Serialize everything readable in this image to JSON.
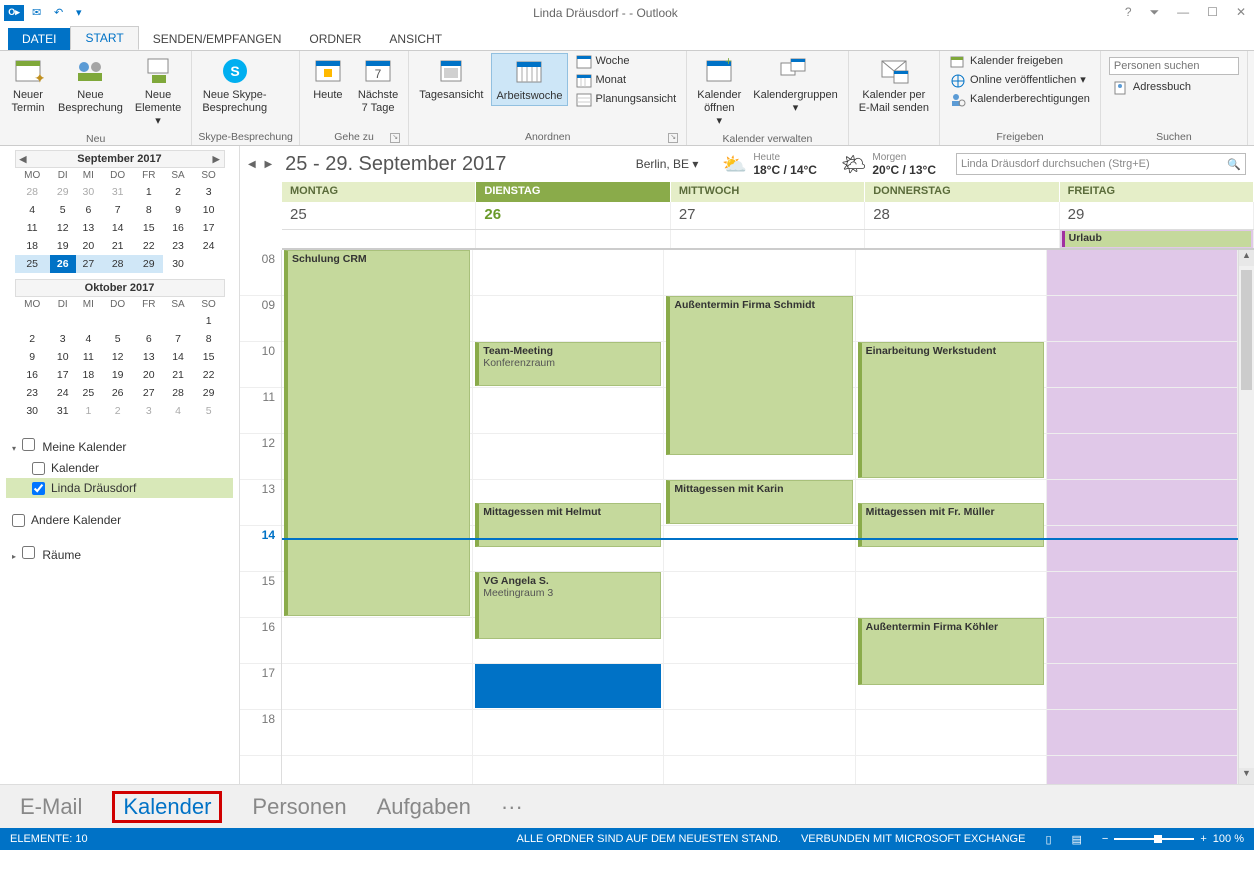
{
  "title": "Linda Dräusdorf -                                               - Outlook",
  "tabs": {
    "file": "DATEI",
    "start": "START",
    "sendrecv": "SENDEN/EMPFANGEN",
    "folder": "ORDNER",
    "view": "ANSICHT"
  },
  "ribbon": {
    "neu": {
      "label": "Neu",
      "termin": "Neuer\nTermin",
      "besp": "Neue\nBesprechung",
      "elem": "Neue\nElemente"
    },
    "skype": {
      "label": "Skype-Besprechung",
      "btn": "Neue Skype-\nBesprechung"
    },
    "gehe": {
      "label": "Gehe zu",
      "heute": "Heute",
      "tage7": "Nächste\n7 Tage"
    },
    "anord": {
      "label": "Anordnen",
      "tag": "Tagesansicht",
      "aw": "Arbeitswoche",
      "woche": "Woche",
      "monat": "Monat",
      "plan": "Planungsansicht"
    },
    "verw": {
      "label": "Kalender verwalten",
      "open": "Kalender\nöffnen",
      "grp": "Kalendergruppen"
    },
    "mail": {
      "label": "",
      "send": "Kalender per\nE-Mail senden"
    },
    "freig": {
      "label": "Freigeben",
      "share": "Kalender freigeben",
      "pub": "Online veröffentlichen",
      "perm": "Kalenderberechtigungen"
    },
    "suchen": {
      "label": "Suchen",
      "placeholder": "Personen suchen",
      "addr": "Adressbuch"
    }
  },
  "mini1": {
    "title": "September 2017",
    "dows": [
      "MO",
      "DI",
      "MI",
      "DO",
      "FR",
      "SA",
      "SO"
    ],
    "rows": [
      [
        "28",
        "29",
        "30",
        "31",
        "1",
        "2",
        "3"
      ],
      [
        "4",
        "5",
        "6",
        "7",
        "8",
        "9",
        "10"
      ],
      [
        "11",
        "12",
        "13",
        "14",
        "15",
        "16",
        "17"
      ],
      [
        "18",
        "19",
        "20",
        "21",
        "22",
        "23",
        "24"
      ],
      [
        "25",
        "26",
        "27",
        "28",
        "29",
        "30",
        ""
      ]
    ]
  },
  "mini2": {
    "title": "Oktober 2017",
    "dows": [
      "MO",
      "DI",
      "MI",
      "DO",
      "FR",
      "SA",
      "SO"
    ],
    "rows": [
      [
        "",
        "",
        "",
        "",
        "",
        "",
        "1"
      ],
      [
        "2",
        "3",
        "4",
        "5",
        "6",
        "7",
        "8"
      ],
      [
        "9",
        "10",
        "11",
        "12",
        "13",
        "14",
        "15"
      ],
      [
        "16",
        "17",
        "18",
        "19",
        "20",
        "21",
        "22"
      ],
      [
        "23",
        "24",
        "25",
        "26",
        "27",
        "28",
        "29"
      ],
      [
        "30",
        "31",
        "1",
        "2",
        "3",
        "4",
        "5"
      ]
    ]
  },
  "callist": {
    "mine": "Meine Kalender",
    "kal": "Kalender",
    "linda": "Linda Dräusdorf",
    "other": "Andere Kalender",
    "rooms": "Räume"
  },
  "header": {
    "range": "25 - 29. September 2017",
    "location": "Berlin, BE",
    "today_label": "Heute",
    "today_temp": "18°C / 14°C",
    "tomorrow_label": "Morgen",
    "tomorrow_temp": "20°C / 13°C",
    "search_ph": "Linda Dräusdorf durchsuchen (Strg+E)"
  },
  "days": [
    "MONTAG",
    "DIENSTAG",
    "MITTWOCH",
    "DONNERSTAG",
    "FREITAG"
  ],
  "dates": [
    "25",
    "26",
    "27",
    "28",
    "29"
  ],
  "allday": {
    "urlaub": "Urlaub"
  },
  "hours": [
    "08",
    "09",
    "10",
    "11",
    "12",
    "13",
    "14",
    "15",
    "16",
    "17",
    "18"
  ],
  "events": {
    "schulung": "Schulung CRM",
    "team": "Team-Meeting",
    "team_room": "Konferenzraum",
    "helmut": "Mittagessen mit Helmut",
    "vg": "VG Angela S.",
    "vg_room": "Meetingraum 3",
    "schmidt": "Außentermin Firma Schmidt",
    "karin": "Mittagessen mit Karin",
    "einarb": "Einarbeitung Werkstudent",
    "mueller": "Mittagessen mit  Fr. Müller",
    "koehler": "Außentermin Firma Köhler"
  },
  "nav": {
    "mail": "E-Mail",
    "cal": "Kalender",
    "pers": "Personen",
    "tasks": "Aufgaben"
  },
  "status": {
    "items": "ELEMENTE: 10",
    "sync": "ALLE ORDNER SIND AUF DEM NEUESTEN STAND.",
    "conn": "VERBUNDEN MIT MICROSOFT EXCHANGE",
    "zoom": "100 %"
  }
}
